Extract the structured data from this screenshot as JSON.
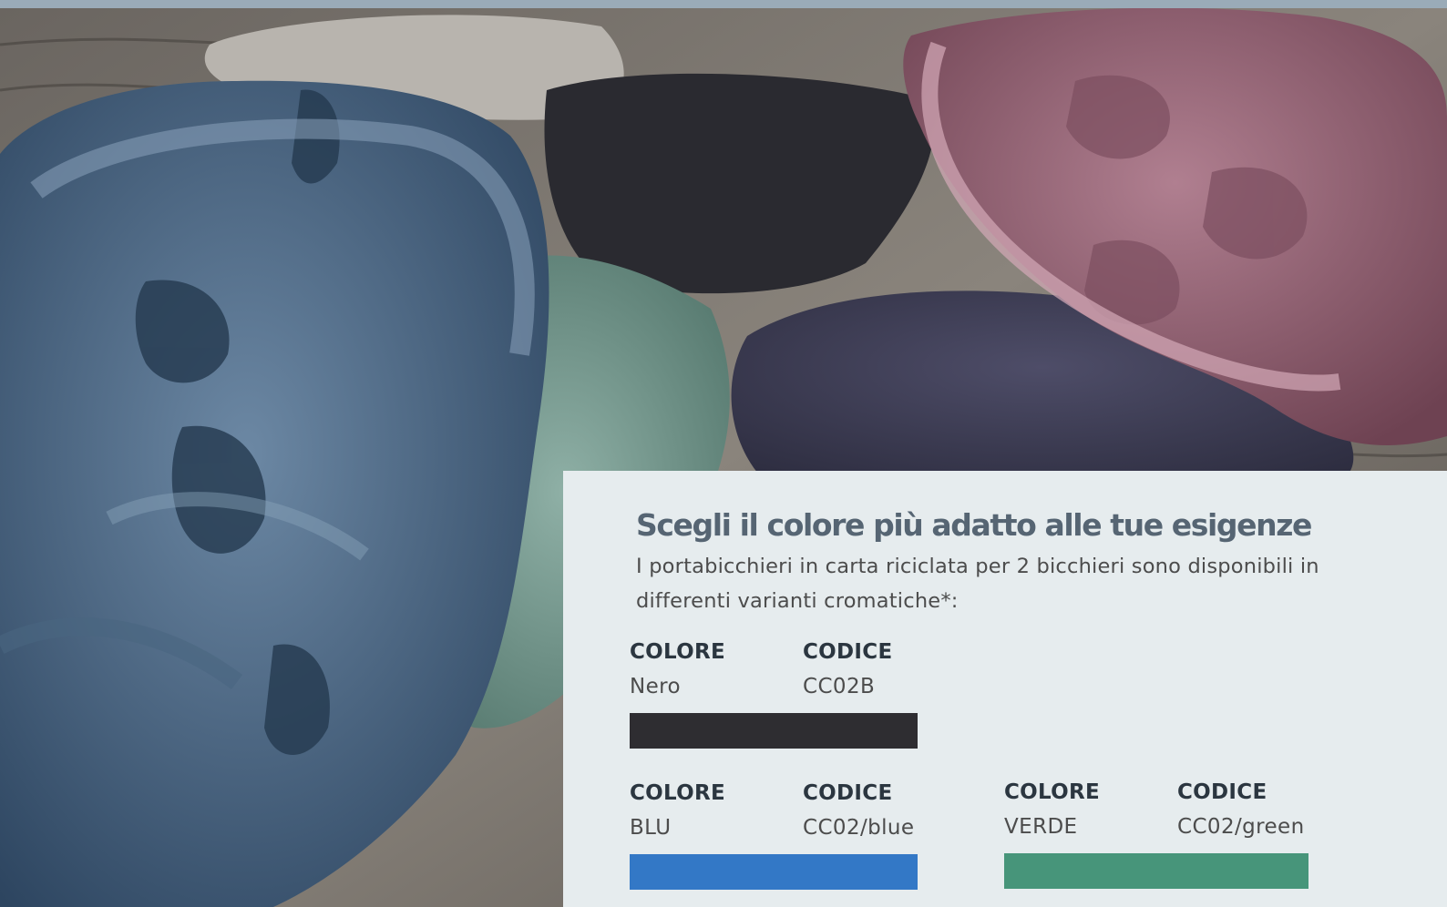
{
  "hero": {
    "subject": "paper-pulp-cup-carriers-photo"
  },
  "panel": {
    "title": "Scegli il colore più adatto alle tue esigenze",
    "intro": "I portabicchieri in carta riciclata per 2 bicchieri sono disponibili in differenti varianti cromatiche*:",
    "swatches": [
      {
        "color_label": "COLORE",
        "code_label": "CODICE",
        "color_name": "Nero",
        "code": "CC02B",
        "hex": "#2e2d31"
      },
      {
        "color_label": "COLORE",
        "code_label": "CODICE",
        "color_name": "BLU",
        "code": "CC02/blue",
        "hex": "#3378c6"
      },
      {
        "color_label": "COLORE",
        "code_label": "CODICE",
        "color_name": "VERDE",
        "code": "CC02/green",
        "hex": "#47957a"
      }
    ]
  }
}
